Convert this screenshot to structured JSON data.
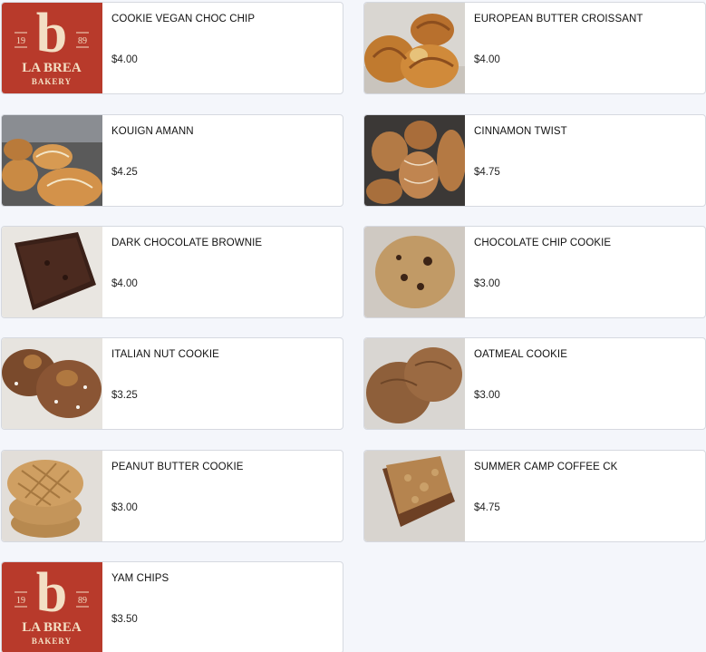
{
  "menu": {
    "items": [
      {
        "name": "COOKIE VEGAN CHOC CHIP",
        "price": "$4.00",
        "image": "logo"
      },
      {
        "name": "EUROPEAN BUTTER CROISSANT",
        "price": "$4.00",
        "image": "croissant"
      },
      {
        "name": "KOUIGN AMANN",
        "price": "$4.25",
        "image": "kouign"
      },
      {
        "name": "CINNAMON TWIST",
        "price": "$4.75",
        "image": "twist"
      },
      {
        "name": "DARK CHOCOLATE BROWNIE",
        "price": "$4.00",
        "image": "brownie"
      },
      {
        "name": "CHOCOLATE CHIP COOKIE",
        "price": "$3.00",
        "image": "chocchip"
      },
      {
        "name": "ITALIAN NUT COOKIE",
        "price": "$3.25",
        "image": "italian"
      },
      {
        "name": "OATMEAL COOKIE",
        "price": "$3.00",
        "image": "oatmeal"
      },
      {
        "name": "PEANUT BUTTER COOKIE",
        "price": "$3.00",
        "image": "peanut"
      },
      {
        "name": "SUMMER CAMP COFFEE CK",
        "price": "$4.75",
        "image": "coffeecake"
      },
      {
        "name": "YAM CHIPS",
        "price": "$3.50",
        "image": "logo"
      }
    ]
  },
  "logo": {
    "letter": "b",
    "year_left": "19",
    "year_right": "89",
    "brand_line1": "LA BREA",
    "brand_line2": "BAKERY"
  },
  "colors": {
    "logo_red": "#b83a2b",
    "logo_cream": "#f3dfc4",
    "card_border": "#d6d9e0",
    "background": "#f4f6fb"
  }
}
